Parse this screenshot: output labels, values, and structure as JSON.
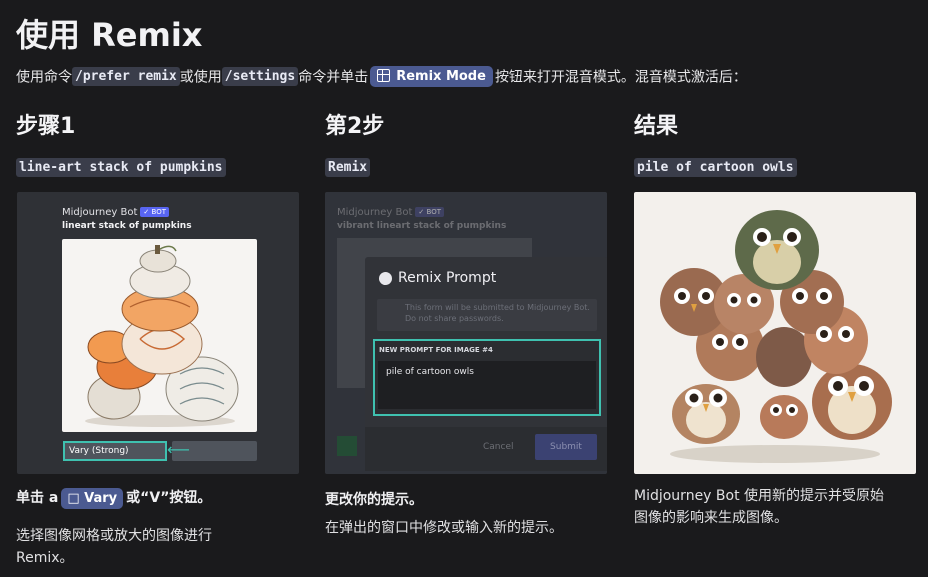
{
  "title": "使用 Remix",
  "intro": {
    "text1": "使用命令",
    "cmd1": "/prefer remix",
    "text2": "或使用",
    "cmd2": "/settings",
    "text3": "命令并单击",
    "button_label": "Remix Mode",
    "text4": "按钮来打开混音模式。混音模式激活后："
  },
  "steps": [
    {
      "heading": "步骤1",
      "tag": "line-art stack of pumpkins",
      "screen": {
        "bot_name": "Midjourney Bot",
        "bot_badge": "✓ BOT",
        "prompt": "lineart stack of pumpkins",
        "vary_button": "Vary (Strong)"
      },
      "caption_pre": "单击 a",
      "caption_button": "□ Vary",
      "caption_post": "或“V”按钮。",
      "caption_line1": "选择图像网格或放大的图像进行",
      "caption_line2": "Remix。"
    },
    {
      "heading": "第2步",
      "tag": "Remix",
      "screen": {
        "bot_name": "Midjourney Bot",
        "bot_badge": "✓ BOT",
        "prompt": "vibrant lineart stack of pumpkins",
        "modal_title": "Remix Prompt",
        "warning_line1": "This form will be submitted to Midjourney Bot.",
        "warning_line2": "Do not share passwords.",
        "field_label": "NEW PROMPT FOR IMAGE #4",
        "field_value": "pile of cartoon owls",
        "cancel": "Cancel",
        "submit": "Submit"
      },
      "caption_bold": "更改你的提示。",
      "caption": "在弹出的窗口中修改或输入新的提示。"
    },
    {
      "heading": "结果",
      "tag": "pile of cartoon owls",
      "caption_line1": "Midjourney Bot 使用新的提示并受原始",
      "caption_line2": "图像的影响来生成图像。"
    }
  ],
  "colors": {
    "background": "#1a1a1c",
    "code_bg": "#3a3d4a",
    "accent_button": "#4b5a91",
    "highlight": "#3fc1b0"
  }
}
